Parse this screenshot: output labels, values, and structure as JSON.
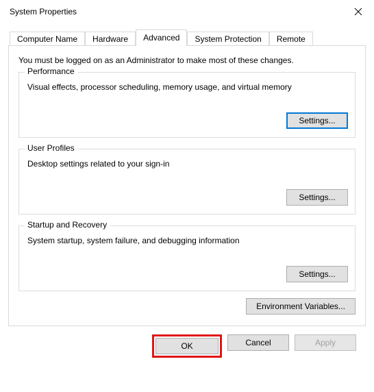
{
  "window": {
    "title": "System Properties"
  },
  "tabs": {
    "items": [
      {
        "label": "Computer Name"
      },
      {
        "label": "Hardware"
      },
      {
        "label": "Advanced"
      },
      {
        "label": "System Protection"
      },
      {
        "label": "Remote"
      }
    ],
    "active_index": 2
  },
  "panel": {
    "admin_note": "You must be logged on as an Administrator to make most of these changes.",
    "groups": {
      "performance": {
        "legend": "Performance",
        "desc": "Visual effects, processor scheduling, memory usage, and virtual memory",
        "button": "Settings..."
      },
      "user_profiles": {
        "legend": "User Profiles",
        "desc": "Desktop settings related to your sign-in",
        "button": "Settings..."
      },
      "startup": {
        "legend": "Startup and Recovery",
        "desc": "System startup, system failure, and debugging information",
        "button": "Settings..."
      }
    },
    "env_vars_button": "Environment Variables..."
  },
  "footer": {
    "ok": "OK",
    "cancel": "Cancel",
    "apply": "Apply"
  }
}
